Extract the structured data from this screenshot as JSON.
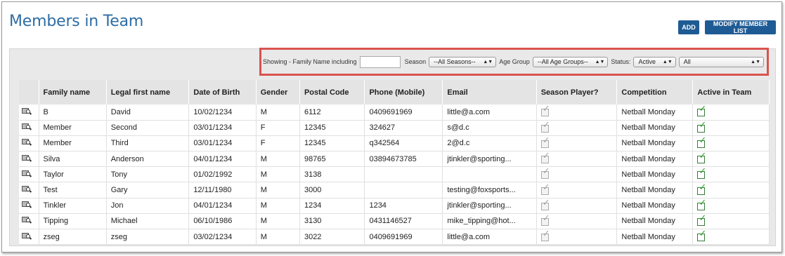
{
  "page": {
    "title": "Members in Team",
    "add_label": "ADD",
    "modify_label": "MODIFY MEMBER LIST"
  },
  "filters": {
    "family_label": "Showing - Family Name including",
    "family_value": "",
    "season_label": "Season",
    "season_value": "--All Seasons--",
    "age_label": "Age Group",
    "age_value": "--All Age Groups--",
    "status_label": "Status:",
    "status_value": "Active",
    "extra_value": "All"
  },
  "table": {
    "headers": [
      "Family name",
      "Legal first name",
      "Date of Birth",
      "Gender",
      "Postal Code",
      "Phone (Mobile)",
      "Email",
      "Season Player?",
      "Competition",
      "Active in Team"
    ],
    "rows": [
      {
        "family": "B",
        "first": "David",
        "dob": "10/02/1234",
        "gender": "M",
        "postal": "6112",
        "phone": "0409691969",
        "email": "little@a.com",
        "season_player": false,
        "competition": "Netball Monday",
        "active": true
      },
      {
        "family": "Member",
        "first": "Second",
        "dob": "03/01/1234",
        "gender": "F",
        "postal": "12345",
        "phone": "324627",
        "email": "s@d.c",
        "season_player": false,
        "competition": "Netball Monday",
        "active": true
      },
      {
        "family": "Member",
        "first": "Third",
        "dob": "03/01/1234",
        "gender": "F",
        "postal": "12345",
        "phone": "q342564",
        "email": "2@d.c",
        "season_player": false,
        "competition": "Netball Monday",
        "active": true
      },
      {
        "family": "Silva",
        "first": "Anderson",
        "dob": "04/01/1234",
        "gender": "M",
        "postal": "98765",
        "phone": "03894673785",
        "email": "jtinkler@sporting...",
        "season_player": false,
        "competition": "Netball Monday",
        "active": true
      },
      {
        "family": "Taylor",
        "first": "Tony",
        "dob": "01/02/1992",
        "gender": "M",
        "postal": "3138",
        "phone": "",
        "email": "",
        "season_player": false,
        "competition": "Netball Monday",
        "active": true
      },
      {
        "family": "Test",
        "first": "Gary",
        "dob": "12/11/1980",
        "gender": "M",
        "postal": "3000",
        "phone": "",
        "email": "testing@foxsports...",
        "season_player": false,
        "competition": "Netball Monday",
        "active": true
      },
      {
        "family": "Tinkler",
        "first": "Jon",
        "dob": "04/01/1234",
        "gender": "M",
        "postal": "1234",
        "phone": "1234",
        "email": "jtinkler@sporting...",
        "season_player": false,
        "competition": "Netball Monday",
        "active": true
      },
      {
        "family": "Tipping",
        "first": "Michael",
        "dob": "06/10/1986",
        "gender": "M",
        "postal": "3130",
        "phone": "0431146527",
        "email": "mike_tipping@hot...",
        "season_player": false,
        "competition": "Netball Monday",
        "active": true
      },
      {
        "family": "zseg",
        "first": "zseg",
        "dob": "03/02/1234",
        "gender": "M",
        "postal": "3022",
        "phone": "0409691969",
        "email": "little@a.com",
        "season_player": false,
        "competition": "Netball Monday",
        "active": true
      }
    ]
  },
  "icons": {
    "view": "view-member-icon",
    "check": "checkmark-icon"
  },
  "colors": {
    "title": "#2e6da4",
    "button": "#1e5b94",
    "filter_highlight": "#d9534f",
    "check_active": "#2fa02f",
    "check_inactive": "#a5a5a5"
  }
}
